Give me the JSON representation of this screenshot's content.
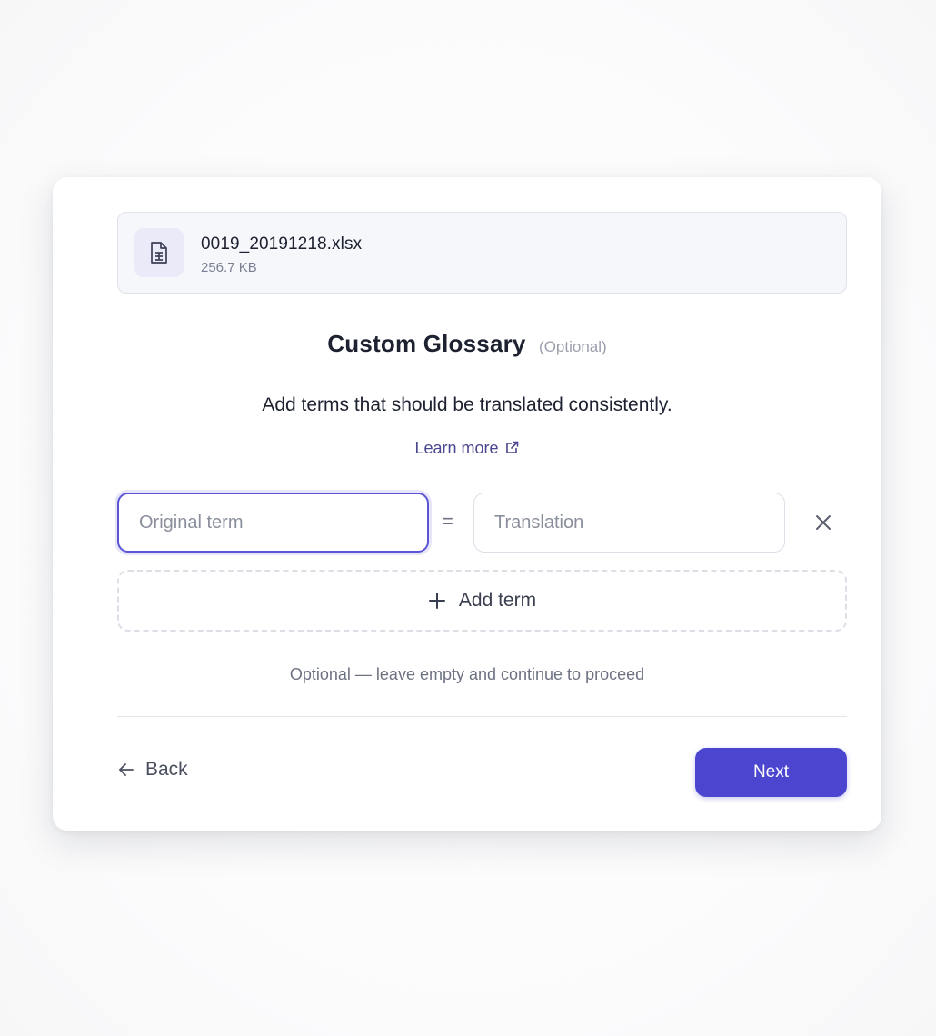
{
  "file": {
    "name": "0019_20191218.xlsx",
    "size": "256.7 KB",
    "icon": "spreadsheet-file-icon"
  },
  "glossary": {
    "title": "Custom Glossary",
    "title_tag": "(Optional)",
    "description": "Add terms that should be translated consistently.",
    "learn_more_label": "Learn more",
    "learn_more_icon": "external-link-icon",
    "original_placeholder": "Original term",
    "original_value": "",
    "equals_sign": "=",
    "translation_placeholder": "Translation",
    "translation_value": "",
    "remove_icon": "close-icon",
    "add_term_label": "Add term",
    "add_term_icon": "plus-icon",
    "hint": "Optional — leave empty and continue to proceed"
  },
  "footer": {
    "back_label": "Back",
    "back_icon": "arrow-left-icon",
    "next_label": "Next"
  },
  "colors": {
    "accent": "#4b45cf",
    "link": "#4a468f",
    "focus_border": "#5b55d6"
  }
}
